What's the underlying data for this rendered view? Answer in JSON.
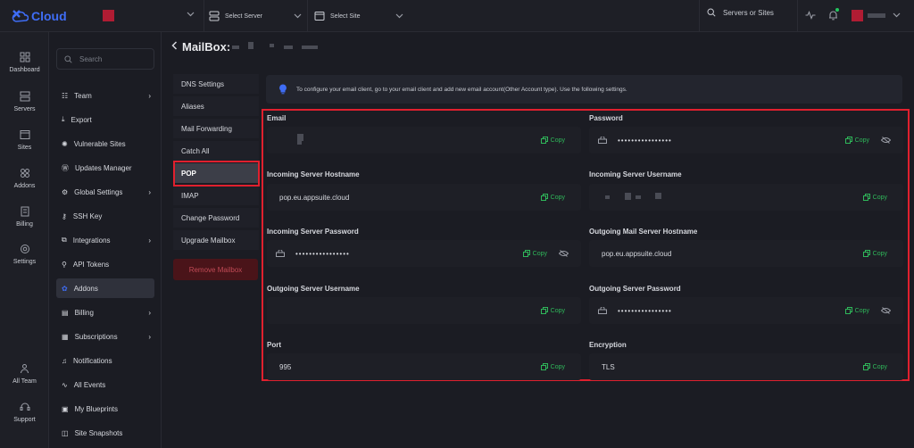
{
  "brand": {
    "name": "Cloud",
    "accent": "#3f6df5",
    "danger": "#e0202e",
    "success": "#2fb85a"
  },
  "topbar": {
    "select_server": "Select Server",
    "select_site": "Select Site",
    "search_label": "Servers or Sites"
  },
  "rail": [
    {
      "label": "Dashboard",
      "icon": "dashboard-icon"
    },
    {
      "label": "Servers",
      "icon": "servers-icon"
    },
    {
      "label": "Sites",
      "icon": "sites-icon"
    },
    {
      "label": "Addons",
      "icon": "addons-icon"
    },
    {
      "label": "Billing",
      "icon": "billing-icon"
    },
    {
      "label": "Settings",
      "icon": "settings-icon"
    },
    {
      "label": "All Team",
      "icon": "team-icon"
    },
    {
      "label": "Support",
      "icon": "support-icon"
    }
  ],
  "sidebar": {
    "search_placeholder": "Search",
    "items": [
      {
        "label": "Team",
        "icon": "team-icon",
        "chevron": true
      },
      {
        "label": "Export",
        "icon": "export-icon"
      },
      {
        "label": "Vulnerable Sites",
        "icon": "bug-icon"
      },
      {
        "label": "Updates Manager",
        "icon": "wordpress-icon"
      },
      {
        "label": "Global Settings",
        "icon": "gear-icon",
        "chevron": true
      },
      {
        "label": "SSH Key",
        "icon": "key-icon"
      },
      {
        "label": "Integrations",
        "icon": "integrations-icon",
        "chevron": true
      },
      {
        "label": "API Tokens",
        "icon": "api-icon"
      },
      {
        "label": "Addons",
        "icon": "addons-icon",
        "active": true
      },
      {
        "label": "Billing",
        "icon": "billing-icon",
        "chevron": true
      },
      {
        "label": "Subscriptions",
        "icon": "subscriptions-icon",
        "chevron": true
      },
      {
        "label": "Notifications",
        "icon": "bell-icon"
      },
      {
        "label": "All Events",
        "icon": "events-icon"
      },
      {
        "label": "My Blueprints",
        "icon": "blueprint-icon"
      },
      {
        "label": "Site Snapshots",
        "icon": "snapshot-icon"
      }
    ]
  },
  "page": {
    "title": "MailBox:"
  },
  "tabs": [
    {
      "label": "DNS Settings"
    },
    {
      "label": "Aliases"
    },
    {
      "label": "Mail Forwarding"
    },
    {
      "label": "Catch All"
    },
    {
      "label": "POP",
      "active": true
    },
    {
      "label": "IMAP"
    },
    {
      "label": "Change Password"
    },
    {
      "label": "Upgrade Mailbox"
    }
  ],
  "remove_button": "Remove Mailbox",
  "info_text": "To configure your email client, go to your email client and add new email account(Other Account type). Use the following settings.",
  "copy_label": "Copy",
  "fields": {
    "email": {
      "label": "Email",
      "value": ""
    },
    "password": {
      "label": "Password",
      "value": "••••••••••••••••"
    },
    "incoming_host": {
      "label": "Incoming Server Hostname",
      "value": "pop.eu.appsuite.cloud"
    },
    "incoming_user": {
      "label": "Incoming Server Username",
      "value": ""
    },
    "incoming_password": {
      "label": "Incoming Server Password",
      "value": "••••••••••••••••"
    },
    "outgoing_host": {
      "label": "Outgoing Mail Server Hostname",
      "value": "pop.eu.appsuite.cloud"
    },
    "outgoing_user": {
      "label": "Outgoing Server Username",
      "value": ""
    },
    "outgoing_password": {
      "label": "Outgoing Server Password",
      "value": "••••••••••••••••"
    },
    "port": {
      "label": "Port",
      "value": "995"
    },
    "encryption": {
      "label": "Encryption",
      "value": "TLS"
    }
  }
}
